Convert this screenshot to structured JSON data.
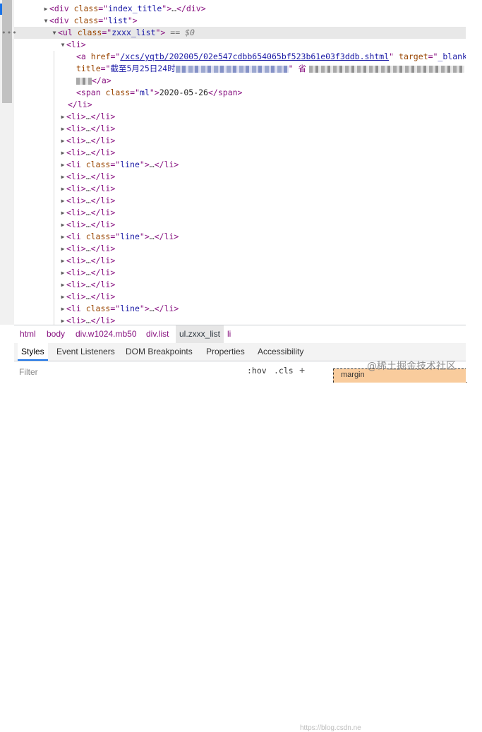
{
  "tree": {
    "row1": {
      "tag_open": "<div ",
      "attr": "class",
      "eq": "=\"",
      "val": "index_title",
      "close": "\">",
      "ellipsis": "…",
      "end": "</div>"
    },
    "row2": {
      "tag_open": "<div ",
      "attr": "class",
      "eq": "=\"",
      "val": "list",
      "close": "\">"
    },
    "row3": {
      "tag_open": "<ul ",
      "attr": "class",
      "eq": "=\"",
      "val": "zxxx_list",
      "close": "\">",
      "marker": "== $0"
    },
    "row4": {
      "text": "<li>"
    },
    "row5": {
      "tag_open": "<a ",
      "href_attr": "href",
      "href_eq": "=\"",
      "href_val": "/xcs/yqtb/202005/02e547cdbb654065bf523b61e03f3ddb.shtml",
      "q1": "\" ",
      "target_attr": "target",
      "target_eq": "=\"",
      "target_val": "_blank",
      "q2": "\""
    },
    "row6": {
      "title_attr": "title",
      "title_eq": "=\"",
      "title_val": "截至5月25日24时",
      "tail": "\" 省"
    },
    "row7": {
      "close": "</a>"
    },
    "row8": {
      "tag_open": "<span ",
      "attr": "class",
      "eq": "=\"",
      "val": "ml",
      "close": "\">",
      "text": "2020-05-26",
      "end": "</span>"
    },
    "row9": {
      "text": "</li>"
    },
    "li_collapsed": {
      "open": "<li>",
      "ellipsis": "…",
      "close": "</li>"
    },
    "li_line": {
      "open": "<li ",
      "attr": "class",
      "eq": "=\"",
      "val": "line",
      "q": "\">",
      "ellipsis": "…",
      "close": "</li>"
    }
  },
  "breadcrumbs": [
    "html",
    "body",
    "div.w1024.mb50",
    "div.list",
    "ul.zxxx_list",
    "li"
  ],
  "tabs": [
    "Styles",
    "Event Listeners",
    "DOM Breakpoints",
    "Properties",
    "Accessibility"
  ],
  "filter": {
    "placeholder": "Filter",
    "hov": ":hov",
    "cls": ".cls",
    "plus": "+"
  },
  "boxmodel": {
    "label": "margin"
  },
  "watermark": "@稀土掘金技术社区",
  "watermark_faint": "https://blog.csdn.ne",
  "icons": {
    "expand": "triangle-right-icon",
    "collapse": "triangle-down-icon"
  },
  "colors": {
    "tag": "#881280",
    "attr_name": "#994500",
    "attr_value": "#1a1aa6",
    "selection": "#e8e8e8",
    "accent": "#1a73e8"
  }
}
